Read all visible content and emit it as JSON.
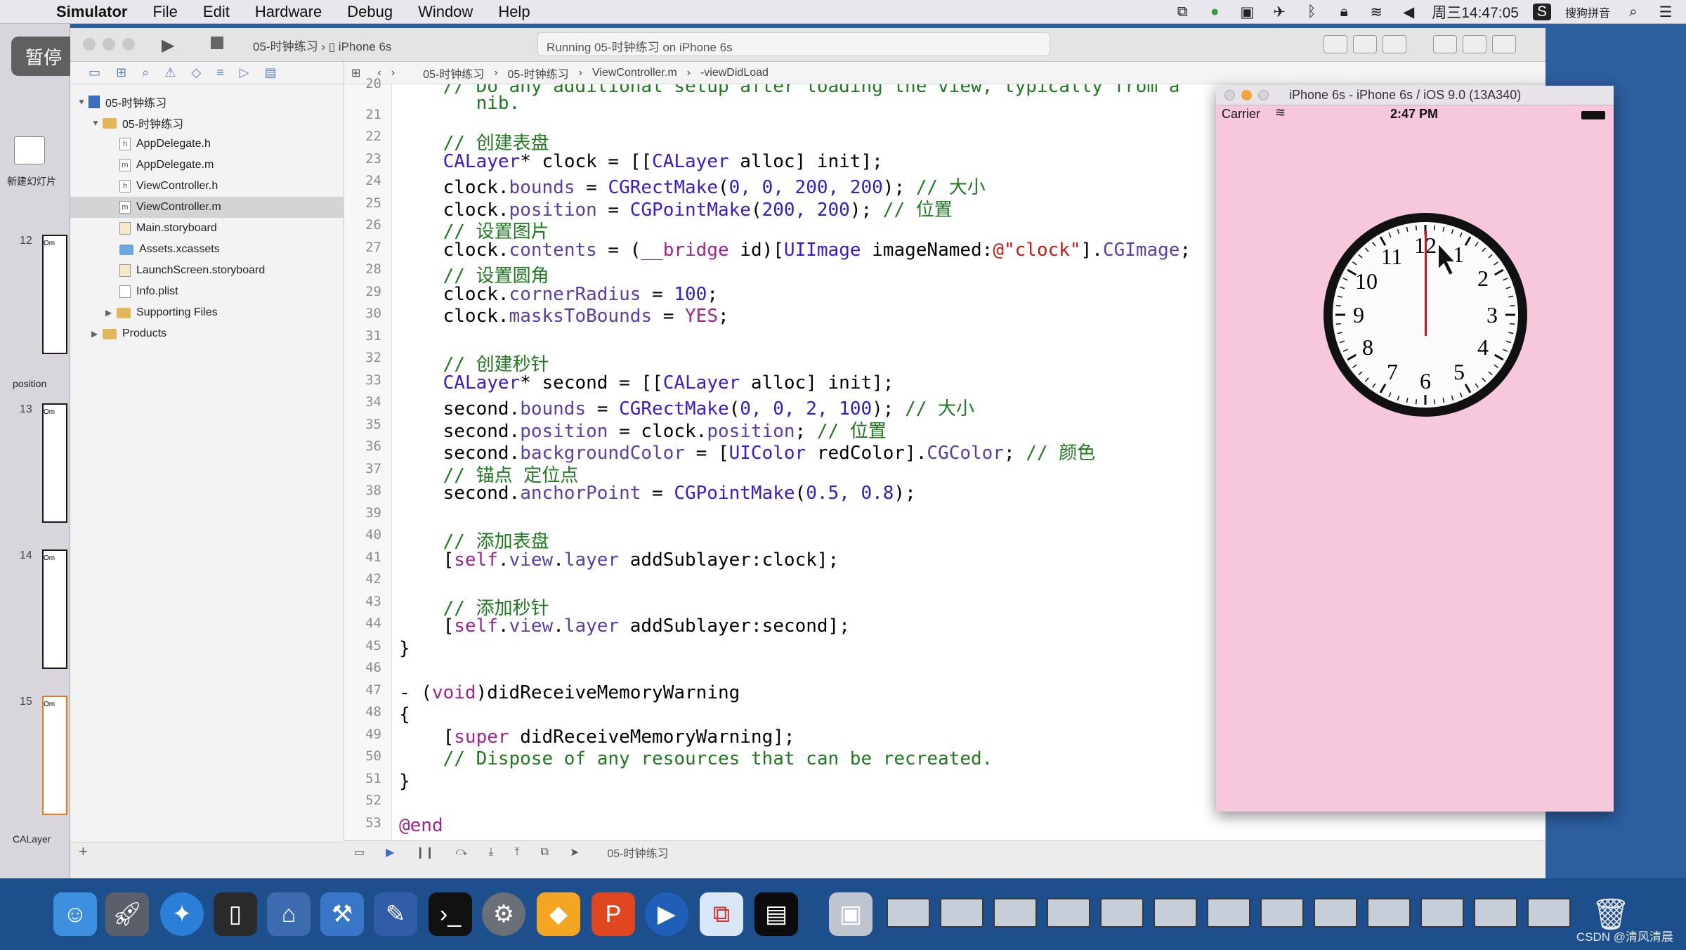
{
  "menubar": {
    "app": "Simulator",
    "items": [
      "File",
      "Edit",
      "Hardware",
      "Debug",
      "Window",
      "Help"
    ],
    "clock": "周三14:47:05",
    "ime": "搜狗拼音"
  },
  "overlay": {
    "pause": "暂停"
  },
  "keynote": {
    "new_slide": "新建幻灯片",
    "section1": "position",
    "section2": "CALayer",
    "slide_numbers": [
      "12",
      "13",
      "14",
      "15"
    ],
    "thumb_text": "Om"
  },
  "xcode": {
    "scheme_target": "05-时钟练习",
    "scheme_device": "iPhone 6s",
    "status": "Running 05-时钟练习 on iPhone 6s",
    "jumpbar": [
      "05-时钟练习",
      "05-时钟练习",
      "ViewController.m",
      "-viewDidLoad"
    ],
    "navigator": {
      "project": "05-时钟练习",
      "group": "05-时钟练习",
      "files": [
        "AppDelegate.h",
        "AppDelegate.m",
        "ViewController.h",
        "ViewController.m",
        "Main.storyboard",
        "Assets.xcassets",
        "LaunchScreen.storyboard",
        "Info.plist"
      ],
      "file_badges": [
        "h",
        "m",
        "h",
        "m",
        "",
        "",
        "",
        ""
      ],
      "supporting": "Supporting Files",
      "products": "Products"
    },
    "debug_target": "05-时钟练习",
    "add_button": "+",
    "line_numbers": [
      "20",
      "21",
      "22",
      "23",
      "24",
      "25",
      "26",
      "27",
      "28",
      "29",
      "30",
      "31",
      "32",
      "33",
      "34",
      "35",
      "36",
      "37",
      "38",
      "39",
      "40",
      "41",
      "42",
      "43",
      "44",
      "45",
      "46",
      "47",
      "48",
      "49",
      "50",
      "51",
      "52",
      "53"
    ],
    "code": {
      "l20a": "    // Do any additional setup after loading the view, typically from a",
      "l20b": "       nib.",
      "l22": "    // 创建表盘",
      "l23_a": "    ",
      "l23_t": "CALayer",
      "l23_b": "* clock = [[",
      "l23_t2": "CALayer",
      "l23_c": " alloc] init];",
      "l24_a": "    clock.",
      "l24_p": "bounds",
      "l24_b": " = ",
      "l24_f": "CGRectMake",
      "l24_c": "(",
      "l24_n": "0, 0, 200, 200",
      "l24_d": "); ",
      "l24_cm": "// 大小",
      "l25_a": "    clock.",
      "l25_p": "position",
      "l25_b": " = ",
      "l25_f": "CGPointMake",
      "l25_c": "(",
      "l25_n": "200, 200",
      "l25_d": "); ",
      "l25_cm": "// 位置",
      "l26": "    // 设置图片",
      "l27_a": "    clock.",
      "l27_p": "contents",
      "l27_b": " = (",
      "l27_k": "__bridge",
      "l27_c": " id)[",
      "l27_t": "UIImage",
      "l27_d": " imageNamed:",
      "l27_s": "@\"clock\"",
      "l27_e": "].",
      "l27_p2": "CGImage",
      "l27_f": ";",
      "l28": "    // 设置圆角",
      "l29_a": "    clock.",
      "l29_p": "cornerRadius",
      "l29_b": " = ",
      "l29_n": "100",
      "l29_c": ";",
      "l30_a": "    clock.",
      "l30_p": "masksToBounds",
      "l30_b": " = ",
      "l30_k": "YES",
      "l30_c": ";",
      "l32": "    // 创建秒针",
      "l33_a": "    ",
      "l33_t": "CALayer",
      "l33_b": "* second = [[",
      "l33_t2": "CALayer",
      "l33_c": " alloc] init];",
      "l34_a": "    second.",
      "l34_p": "bounds",
      "l34_b": " = ",
      "l34_f": "CGRectMake",
      "l34_c": "(",
      "l34_n": "0, 0, 2, 100",
      "l34_d": "); ",
      "l34_cm": "// 大小",
      "l35_a": "    second.",
      "l35_p": "position",
      "l35_b": " = clock.",
      "l35_p2": "position",
      "l35_c": "; ",
      "l35_cm": "// 位置",
      "l36_a": "    second.",
      "l36_p": "backgroundColor",
      "l36_b": " = [",
      "l36_t": "UIColor",
      "l36_c": " redColor].",
      "l36_p2": "CGColor",
      "l36_d": "; ",
      "l36_cm": "// 颜色",
      "l37": "    // 锚点 定位点",
      "l38_a": "    second.",
      "l38_p": "anchorPoint",
      "l38_b": " = ",
      "l38_f": "CGPointMake",
      "l38_c": "(",
      "l38_n": "0.5, 0.8",
      "l38_d": ");",
      "l40": "    // 添加表盘",
      "l41_a": "    [",
      "l41_k": "self",
      "l41_b": ".",
      "l41_p": "view",
      "l41_c": ".",
      "l41_p2": "layer",
      "l41_d": " addSublayer:clock];",
      "l43": "    // 添加秒针",
      "l44_a": "    [",
      "l44_k": "self",
      "l44_b": ".",
      "l44_p": "view",
      "l44_c": ".",
      "l44_p2": "layer",
      "l44_d": " addSublayer:second];",
      "l45": "}",
      "l47_a": "- (",
      "l47_k": "void",
      "l47_b": ")didReceiveMemoryWarning",
      "l48": "{",
      "l49_a": "    [",
      "l49_k": "super",
      "l49_b": " didReceiveMemoryWarning];",
      "l50": "    // Dispose of any resources that can be recreated.",
      "l51": "}",
      "l53": "@end"
    }
  },
  "simulator": {
    "title": "iPhone 6s - iPhone 6s / iOS 9.0 (13A340)",
    "carrier": "Carrier",
    "time": "2:47 PM",
    "clock_numbers": [
      "12",
      "1",
      "2",
      "3",
      "4",
      "5",
      "6",
      "7",
      "8",
      "9",
      "10",
      "11"
    ],
    "second_hand_color": "#d0141c",
    "background": "#f7c8dc"
  },
  "watermark": "CSDN @清风清晨"
}
